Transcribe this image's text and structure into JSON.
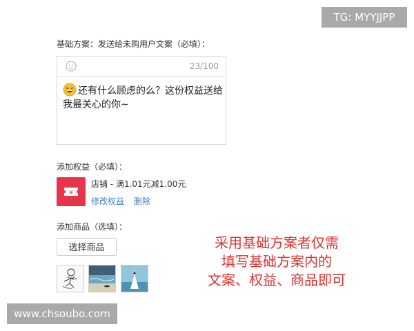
{
  "watermarks": {
    "top_right": "TG: MYYJJPP",
    "bottom_left": "www.chsoubo.com"
  },
  "basic_plan": {
    "label": "基础方案：发送给未购用户文案（必填）：",
    "char_count": "23/100",
    "message_text": "还有什么顾虑的么？这份权益送给我最关心的你~",
    "emoji_icon": "smile-face-icon"
  },
  "benefit": {
    "label": "添加权益（必填）：",
    "name": "店铺 - 满1.01元减1.00元",
    "icon_glyph": "¥",
    "icon_color": "#e6354a",
    "edit_link": "修改权益",
    "delete_link": "删除"
  },
  "products": {
    "label": "添加商品（选填）：",
    "select_button": "选择商品",
    "thumbnails": [
      "sketch-figure-image",
      "beach-scene-image",
      "woman-in-white-dress-image"
    ]
  },
  "note": {
    "line1": "采用基础方案者仅需",
    "line2": "填写基础方案内的",
    "line3": "文案、权益、商品即可",
    "color": "#e0312d"
  },
  "colors": {
    "link": "#3d7fd0",
    "border": "#d6d6d6",
    "watermark_bg": "#a9a9a9"
  }
}
